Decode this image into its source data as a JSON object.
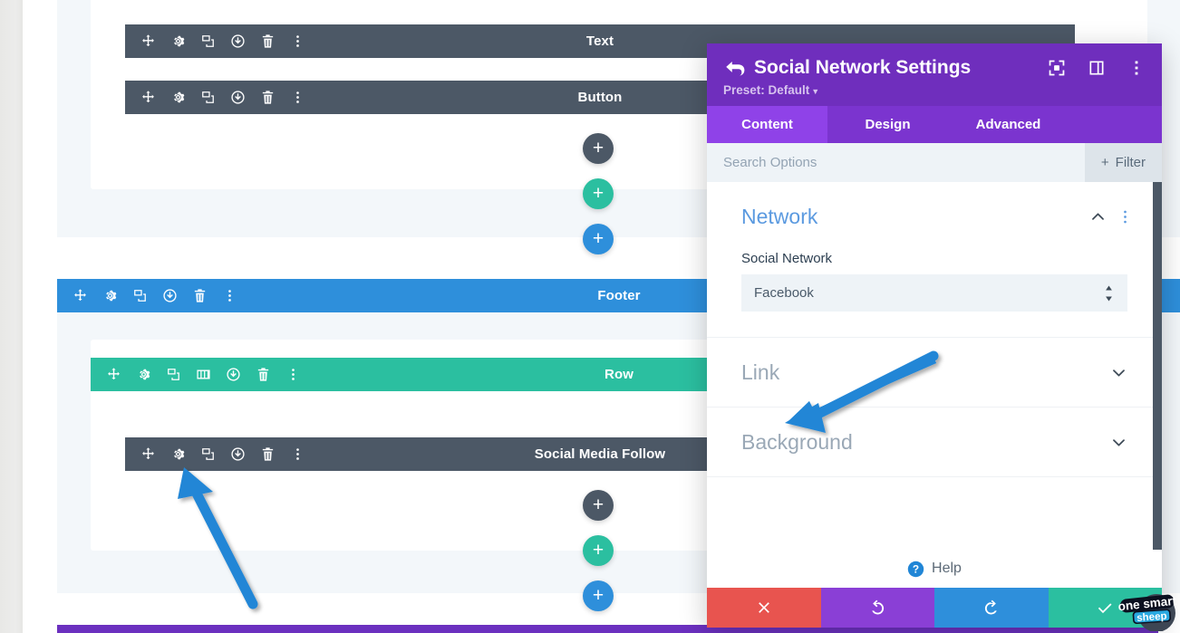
{
  "builder": {
    "bars": [
      {
        "label": "Text",
        "type": "module",
        "icons": [
          "move-icon",
          "gear-icon",
          "duplicate-icon",
          "save-icon",
          "trash-icon",
          "more-options-icon"
        ]
      },
      {
        "label": "Button",
        "type": "module",
        "icons": [
          "move-icon",
          "gear-icon",
          "duplicate-icon",
          "save-icon",
          "trash-icon",
          "more-options-icon"
        ]
      },
      {
        "label": "Footer",
        "type": "section",
        "icons": [
          "move-icon",
          "gear-icon",
          "duplicate-icon",
          "save-icon",
          "trash-icon",
          "more-options-icon"
        ]
      },
      {
        "label": "Row",
        "type": "row",
        "icons": [
          "move-icon",
          "gear-icon",
          "duplicate-icon",
          "columns-icon",
          "save-icon",
          "trash-icon",
          "more-options-icon"
        ]
      },
      {
        "label": "Social Media Follow",
        "type": "module",
        "icons": [
          "move-icon",
          "gear-icon",
          "duplicate-icon",
          "save-icon",
          "trash-icon",
          "more-options-icon"
        ]
      }
    ],
    "add_buttons": [
      {
        "name": "add-module-button",
        "symbol": "+",
        "color": "#4c5866"
      },
      {
        "name": "add-row-button",
        "symbol": "+",
        "color": "#2bbfa0"
      },
      {
        "name": "add-section-button",
        "symbol": "+",
        "color": "#2e8fdb"
      }
    ]
  },
  "modal": {
    "title": "Social Network Settings",
    "preset_label": "Preset: Default",
    "header_icons": [
      "focus-icon",
      "layout-panel-icon",
      "more-options-icon"
    ],
    "back_icon": "back-arrow-icon",
    "tabs": [
      {
        "label": "Content",
        "active": true
      },
      {
        "label": "Design",
        "active": false
      },
      {
        "label": "Advanced",
        "active": false
      }
    ],
    "search": {
      "value": "",
      "placeholder": "Search Options"
    },
    "filter_label": "Filter",
    "groups": [
      {
        "title": "Network",
        "state": "open",
        "chevron": "chevron-up-icon",
        "has_dots": true
      },
      {
        "title": "Link",
        "state": "closed",
        "chevron": "chevron-down-icon",
        "has_dots": false
      },
      {
        "title": "Background",
        "state": "closed",
        "chevron": "chevron-down-icon",
        "has_dots": false
      }
    ],
    "fields": {
      "social_network": {
        "label": "Social Network",
        "value": "Facebook",
        "options": [
          "Facebook"
        ]
      }
    },
    "help_label": "Help",
    "footer_buttons": [
      {
        "name": "cancel-button",
        "icon": "close-icon",
        "color": "#e8544f"
      },
      {
        "name": "undo-button",
        "icon": "undo-icon",
        "color": "#8a3fd6"
      },
      {
        "name": "redo-button",
        "icon": "redo-icon",
        "color": "#2e8fdb"
      },
      {
        "name": "save-button",
        "icon": "check-icon",
        "color": "#2bbfa0"
      }
    ]
  },
  "annotations": {
    "arrows": [
      {
        "name": "arrow-pointing-to-link-section",
        "color": "#2186d6"
      },
      {
        "name": "arrow-pointing-to-module-gear-icon",
        "color": "#2186d6"
      }
    ]
  },
  "watermark": {
    "line1": "one smart",
    "line2": "sheep"
  },
  "colors": {
    "module_bar": "#4c5866",
    "section_bar": "#2e8fdb",
    "row_bar": "#2bbfa0",
    "modal_header": "#6f2ebd",
    "tab_active": "#8f42e8",
    "accent_blue": "#5b9ae0"
  }
}
